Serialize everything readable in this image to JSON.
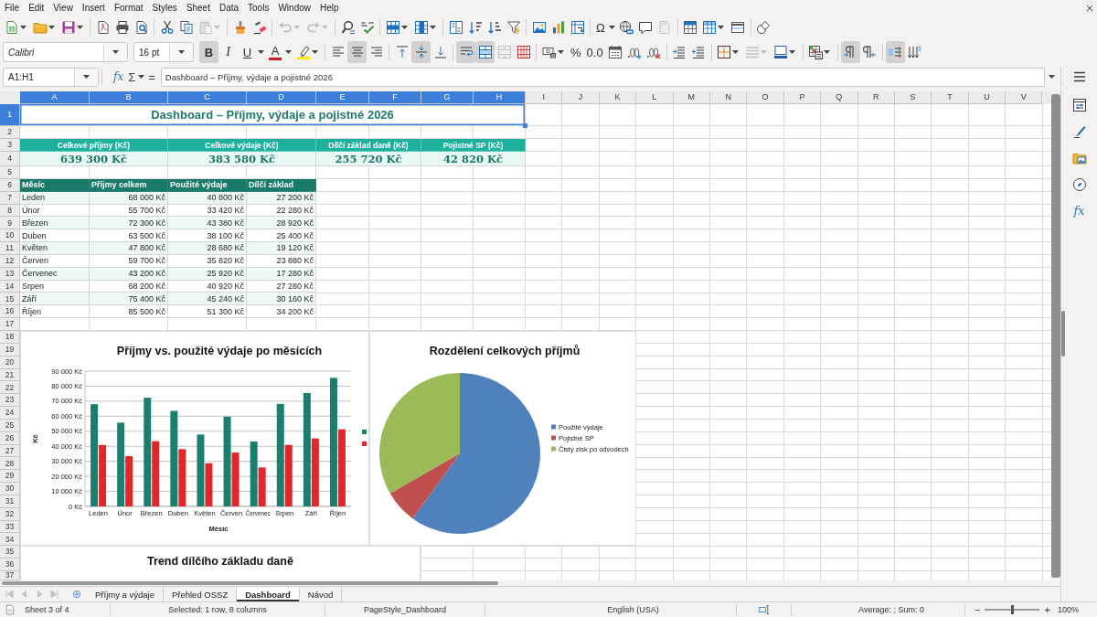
{
  "menu_bar": [
    "File",
    "Edit",
    "View",
    "Insert",
    "Format",
    "Styles",
    "Sheet",
    "Data",
    "Tools",
    "Window",
    "Help"
  ],
  "standard_toolbar": {
    "paste": {
      "disabled": true
    },
    "undo": {
      "disabled": true
    },
    "redo": {
      "disabled": true
    },
    "special_character": {
      "label": "Ω"
    },
    "header_footer": {
      "disabled": true
    }
  },
  "formatting_toolbar": {
    "font_name": "Calibri",
    "font_size": "16 pt",
    "text_style": [
      {
        "kind": "bold",
        "label": "B",
        "on": true
      },
      {
        "kind": "italic",
        "label": "I",
        "on": false
      },
      {
        "kind": "underline",
        "label": "U",
        "on": false
      }
    ],
    "font_color": {
      "label": "A"
    },
    "horizontal_align": [
      {
        "selected": false
      },
      {
        "selected": true
      },
      {
        "selected": false
      }
    ],
    "vertical_align": [
      {
        "selected": false
      },
      {
        "selected": true
      },
      {
        "selected": false
      }
    ],
    "wrap_text": {
      "on": true
    },
    "merge_and_center": {
      "on": true
    },
    "merge_cells": {
      "disabled": true
    },
    "percent": {
      "label": "%"
    },
    "number": {
      "label": "0.0"
    },
    "border_style": {
      "disabled": true
    },
    "paragraph_direction": [
      {
        "selected": true
      },
      {
        "selected": false
      }
    ],
    "text_orientation": [
      {
        "selected": true
      },
      {
        "selected": false
      }
    ]
  },
  "formula_bar": {
    "name_box": "A1:H1",
    "function_wizard": "fx",
    "sum": "Σ",
    "formula": "=",
    "content": "Dashboard – Příjmy, výdaje a pojistné 2026"
  },
  "sheet": {
    "column_headers": [
      {
        "label": "A",
        "selected": true
      },
      {
        "label": "B",
        "selected": true
      },
      {
        "label": "C",
        "selected": true
      },
      {
        "label": "D",
        "selected": true
      },
      {
        "label": "E",
        "selected": true
      },
      {
        "label": "F",
        "selected": true
      },
      {
        "label": "G",
        "selected": true
      },
      {
        "label": "H",
        "selected": true
      },
      {
        "label": "I",
        "selected": false
      },
      {
        "label": "J",
        "selected": false
      },
      {
        "label": "K",
        "selected": false
      },
      {
        "label": "L",
        "selected": false
      },
      {
        "label": "M",
        "selected": false
      },
      {
        "label": "N",
        "selected": false
      },
      {
        "label": "O",
        "selected": false
      },
      {
        "label": "P",
        "selected": false
      },
      {
        "label": "Q",
        "selected": false
      },
      {
        "label": "R",
        "selected": false
      },
      {
        "label": "S",
        "selected": false
      },
      {
        "label": "T",
        "selected": false
      },
      {
        "label": "U",
        "selected": false
      },
      {
        "label": "V",
        "selected": false
      }
    ],
    "row_headers": [
      {
        "label": "1",
        "selected": true
      },
      {
        "label": "2",
        "selected": false
      },
      {
        "label": "3",
        "selected": false
      },
      {
        "label": "4",
        "selected": false
      },
      {
        "label": "5",
        "selected": false
      },
      {
        "label": "6",
        "selected": false
      },
      {
        "label": "7",
        "selected": false
      },
      {
        "label": "8",
        "selected": false
      },
      {
        "label": "9",
        "selected": false
      },
      {
        "label": "10",
        "selected": false
      },
      {
        "label": "11",
        "selected": false
      },
      {
        "label": "12",
        "selected": false
      },
      {
        "label": "13",
        "selected": false
      },
      {
        "label": "14",
        "selected": false
      },
      {
        "label": "15",
        "selected": false
      },
      {
        "label": "16",
        "selected": false
      },
      {
        "label": "17",
        "selected": false
      },
      {
        "label": "18",
        "selected": false
      },
      {
        "label": "19",
        "selected": false
      },
      {
        "label": "20",
        "selected": false
      },
      {
        "label": "21",
        "selected": false
      },
      {
        "label": "22",
        "selected": false
      },
      {
        "label": "23",
        "selected": false
      },
      {
        "label": "24",
        "selected": false
      },
      {
        "label": "25",
        "selected": false
      },
      {
        "label": "26",
        "selected": false
      },
      {
        "label": "27",
        "selected": false
      },
      {
        "label": "28",
        "selected": false
      },
      {
        "label": "29",
        "selected": false
      },
      {
        "label": "30",
        "selected": false
      },
      {
        "label": "31",
        "selected": false
      },
      {
        "label": "32",
        "selected": false
      },
      {
        "label": "33",
        "selected": false
      },
      {
        "label": "34",
        "selected": false
      },
      {
        "label": "35",
        "selected": false
      },
      {
        "label": "36",
        "selected": false
      },
      {
        "label": "37",
        "selected": false
      }
    ],
    "title_cell": {
      "text": "Dashboard – Příjmy, výdaje a pojistné 2026",
      "selected": true
    },
    "kpis": [
      {
        "label": "Celkové příjmy (Kč)",
        "value": "639 300 Kč"
      },
      {
        "label": "Celkové výdaje (Kč)",
        "value": "383 580 Kč"
      },
      {
        "label": "Dílčí základ daně (Kč)",
        "value": "255 720 Kč"
      },
      {
        "label": "Pojistné SP (Kč)",
        "value": "42 820 Kč"
      }
    ],
    "table": {
      "columns": [
        "Měsíc",
        "Příjmy celkem",
        "Použité výdaje",
        "Dílčí základ"
      ],
      "rows": [
        {
          "cells": [
            "Leden",
            "68 000 Kč",
            "40 800 Kč",
            "27 200 Kč"
          ],
          "shaded": true
        },
        {
          "cells": [
            "Únor",
            "55 700 Kč",
            "33 420 Kč",
            "22 280 Kč"
          ],
          "shaded": false
        },
        {
          "cells": [
            "Březen",
            "72 300 Kč",
            "43 380 Kč",
            "28 920 Kč"
          ],
          "shaded": true
        },
        {
          "cells": [
            "Duben",
            "63 500 Kč",
            "38 100 Kč",
            "25 400 Kč"
          ],
          "shaded": false
        },
        {
          "cells": [
            "Květen",
            "47 800 Kč",
            "28 680 Kč",
            "19 120 Kč"
          ],
          "shaded": true
        },
        {
          "cells": [
            "Červen",
            "59 700 Kč",
            "35 820 Kč",
            "23 880 Kč"
          ],
          "shaded": false
        },
        {
          "cells": [
            "Červenec",
            "43 200 Kč",
            "25 920 Kč",
            "17 280 Kč"
          ],
          "shaded": true
        },
        {
          "cells": [
            "Srpen",
            "68 200 Kč",
            "40 920 Kč",
            "27 280 Kč"
          ],
          "shaded": false
        },
        {
          "cells": [
            "Září",
            "75 400 Kč",
            "45 240 Kč",
            "30 160 Kč"
          ],
          "shaded": true
        },
        {
          "cells": [
            "Říjen",
            "85 500 Kč",
            "51 300 Kč",
            "34 200 Kč"
          ],
          "shaded": false
        }
      ]
    }
  },
  "bar_chart": {
    "chart_data": {
      "type": "bar",
      "title": "Příjmy vs. použité výdaje po měsících",
      "xlabel": "Měsíc",
      "ylabel": "Kč",
      "categories": [
        "Leden",
        "Únor",
        "Březen",
        "Duben",
        "Květen",
        "Červen",
        "Červenec",
        "Srpen",
        "Září",
        "Říjen"
      ],
      "series": [
        {
          "color": "#1a7f6e",
          "values": [
            68000,
            55700,
            72300,
            63500,
            47800,
            59700,
            43200,
            68200,
            75400,
            85500
          ]
        },
        {
          "color": "#e0282b",
          "values": [
            40800,
            33420,
            43380,
            38100,
            28680,
            35820,
            25920,
            40920,
            45240,
            51300
          ]
        }
      ],
      "ylim": [
        0,
        90000
      ],
      "yticks": [
        {
          "value": 0,
          "label": "0 Kč"
        },
        {
          "value": 10000,
          "label": "10 000 Kč"
        },
        {
          "value": 20000,
          "label": "20 000 Kč"
        },
        {
          "value": 30000,
          "label": "30 000 Kč"
        },
        {
          "value": 40000,
          "label": "40 000 Kč"
        },
        {
          "value": 50000,
          "label": "50 000 Kč"
        },
        {
          "value": 60000,
          "label": "60 000 Kč"
        },
        {
          "value": 70000,
          "label": "70 000 Kč"
        },
        {
          "value": 80000,
          "label": "80 000 Kč"
        },
        {
          "value": 90000,
          "label": "90 000 Kč"
        }
      ],
      "grid": true
    }
  },
  "pie_chart": {
    "chart_data": {
      "type": "pie",
      "title": "Rozdělení celkových příjmů",
      "categories": [
        "Použité výdaje",
        "Pojistné SP",
        "Čistý zisk po odvodech"
      ],
      "values": [
        60.0,
        6.7,
        33.3
      ],
      "legend": "right"
    },
    "slices": [
      {
        "color": "#4f81bd"
      },
      {
        "color": "#c0504d"
      },
      {
        "color": "#9bbb59"
      }
    ]
  },
  "trend_chart": {
    "title": "Trend dílčího základu daně"
  },
  "sidebar": {
    "functions": "fx"
  },
  "sheet_tabs": [
    {
      "label": "Příjmy a výdaje",
      "selected": false
    },
    {
      "label": "Přehled OSSZ",
      "selected": false
    },
    {
      "label": "Dashboard",
      "selected": true
    },
    {
      "label": "Návod",
      "selected": false
    }
  ],
  "status_bar": {
    "sheet": "Sheet 3 of 4",
    "selection": "Selected: 1 row, 8 columns",
    "page_style": "PageStyle_Dashboard",
    "language": "English (USA)",
    "summary": "Average: ; Sum: 0",
    "zoom_out": "−",
    "zoom": {
      "level": 0.5
    },
    "zoom_in": "+",
    "zoom_value": "100%"
  }
}
